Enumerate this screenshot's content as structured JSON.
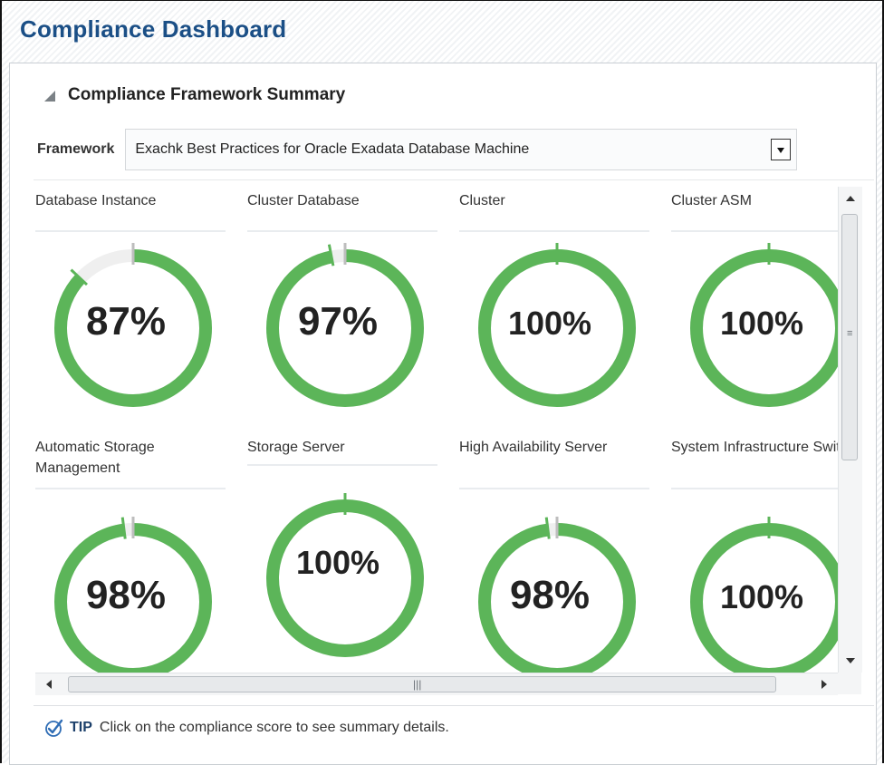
{
  "page": {
    "title": "Compliance Dashboard"
  },
  "section": {
    "title": "Compliance Framework Summary"
  },
  "framework": {
    "label": "Framework",
    "selected": "Exachk Best Practices for Oracle Exadata Database Machine"
  },
  "tiles": [
    {
      "label": "Database Instance",
      "score": "87%",
      "value": 0.87
    },
    {
      "label": "Cluster Database",
      "score": "97%",
      "value": 0.97
    },
    {
      "label": "Cluster",
      "score": "100%",
      "value": 1.0
    },
    {
      "label": "Cluster ASM",
      "score": "100%",
      "value": 1.0
    },
    {
      "label": "Automatic Storage Management",
      "score": "98%",
      "value": 0.98
    },
    {
      "label": "Storage Server",
      "score": "100%",
      "value": 1.0
    },
    {
      "label": "High Availability Server",
      "score": "98%",
      "value": 0.98
    },
    {
      "label": "System Infrastructure Switch",
      "score": "100%",
      "value": 1.0
    }
  ],
  "tip": {
    "label": "TIP",
    "text": "Click on the compliance score to see summary details."
  },
  "colors": {
    "gauge_fill": "#5cb559",
    "gauge_track": "#efefef",
    "title": "#1b4f86",
    "needle_gray": "#bdbdbd"
  },
  "icons": {
    "collapse": "triangle-down-icon",
    "tip": "checkmark-icon",
    "dropdown": "chevron-down-icon"
  }
}
